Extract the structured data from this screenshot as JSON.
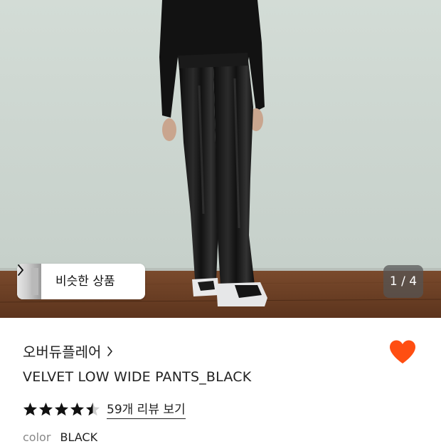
{
  "hero": {
    "page_counter": "1 / 4",
    "similar_products_label": "비슷한 상품"
  },
  "product": {
    "brand": "오버듀플레어",
    "name": "VELVET LOW WIDE PANTS_BLACK",
    "rating": 4.5,
    "max_rating": 5,
    "review_link": "59개 리뷰 보기",
    "color_label": "color",
    "color_value": "BLACK"
  },
  "colors": {
    "heart": "#ff4e12",
    "text": "#222222",
    "muted": "#888888"
  },
  "icons": [
    "chevron-right-icon",
    "heart-icon",
    "star-icon",
    "half-star-icon"
  ]
}
